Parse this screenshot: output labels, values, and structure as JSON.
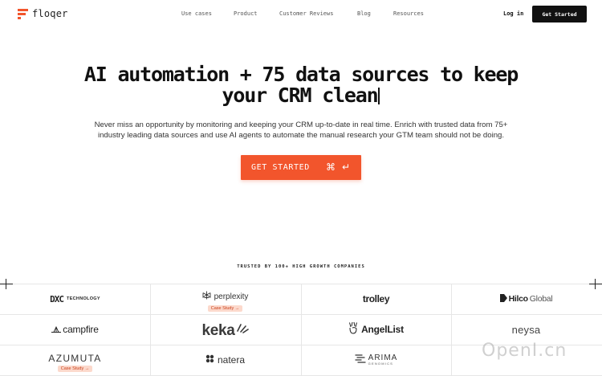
{
  "nav": {
    "brand": "floqer",
    "links": [
      "Use cases",
      "Product",
      "Customer Reviews",
      "Blog",
      "Resources"
    ],
    "login": "Log in",
    "cta": "Get Started"
  },
  "hero": {
    "title_line1": "AI automation + 75 data sources to keep",
    "title_line2": "your CRM clean",
    "subtitle_line1": "Never miss an opportunity by monitoring and keeping your CRM up-to-date in real time. Enrich with trusted data from 75+",
    "subtitle_line2": "industry leading data sources and use AI agents to automate the manual research your GTM team should not be doing.",
    "cta_label": "GET STARTED",
    "cta_key1": "⌘",
    "cta_key2": "↵"
  },
  "trusted": {
    "heading": "TRUSTED BY 100+ HIGH GROWTH COMPANIES"
  },
  "logos": [
    {
      "name": "DXC",
      "sub": "TECHNOLOGY",
      "badge": ""
    },
    {
      "name": "perplexity",
      "sub": "",
      "badge": "Case Study →"
    },
    {
      "name": "trolley",
      "sub": "",
      "badge": ""
    },
    {
      "name": "Hilco",
      "sub": "Global",
      "badge": ""
    },
    {
      "name": "campfire",
      "sub": "",
      "badge": ""
    },
    {
      "name": "keka",
      "sub": "",
      "badge": ""
    },
    {
      "name": "AngelList",
      "sub": "",
      "badge": ""
    },
    {
      "name": "neysa",
      "sub": "",
      "badge": ""
    },
    {
      "name": "AZUMUTA",
      "sub": "",
      "badge": "Case Study →"
    },
    {
      "name": "natera",
      "sub": "",
      "badge": ""
    },
    {
      "name": "ARIMA",
      "sub": "GENOMICS",
      "badge": ""
    },
    {
      "name": "",
      "sub": "",
      "badge": ""
    }
  ],
  "watermark": "OpenI.cn",
  "colors": {
    "accent": "#f2552c",
    "dark": "#111111",
    "badge_bg": "#fcd9cc",
    "grid": "#e6e6e6"
  }
}
